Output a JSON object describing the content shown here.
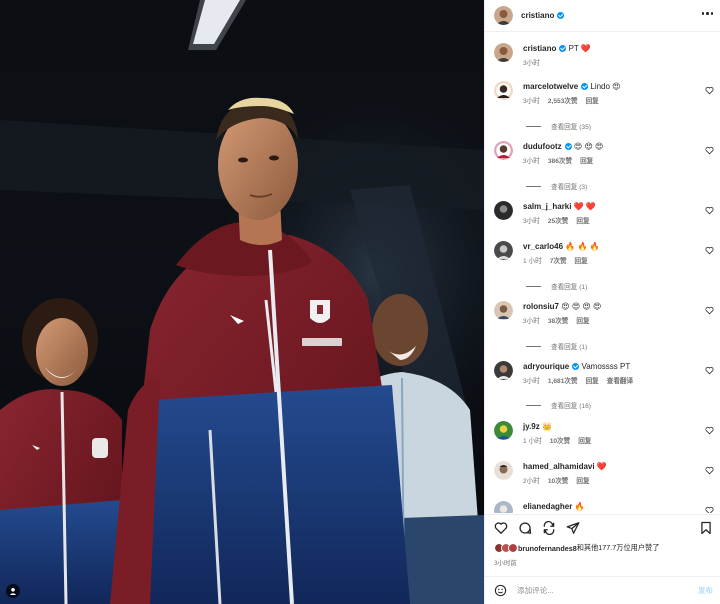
{
  "header": {
    "username": "cristiano",
    "verified": true
  },
  "caption": {
    "username": "cristiano",
    "text": "PT ❤️",
    "time": "3小时"
  },
  "comments": [
    {
      "username": "marcelotwelve",
      "verified": true,
      "text": "Lindo 😍",
      "time": "3小时",
      "likes": "2,553次赞",
      "reply": "回复",
      "translate": "",
      "view_replies": "查看回复 (35)"
    },
    {
      "username": "dudufootz",
      "verified": true,
      "text": "😍 😍 😍",
      "time": "3小时",
      "likes": "386次赞",
      "reply": "回复",
      "translate": "",
      "view_replies": "查看回复 (3)"
    },
    {
      "username": "salm_j_harki",
      "verified": false,
      "text": "❤️ ❤️",
      "time": "3小时",
      "likes": "25次赞",
      "reply": "回复",
      "translate": "",
      "view_replies": ""
    },
    {
      "username": "vr_carlo46",
      "verified": false,
      "text": "🔥 🔥 🔥",
      "time": "1 小时",
      "likes": "7次赞",
      "reply": "回复",
      "translate": "",
      "view_replies": "查看回复 (1)"
    },
    {
      "username": "rolonsiu7",
      "verified": false,
      "text": "😍 😍 😍 😍",
      "time": "3小时",
      "likes": "38次赞",
      "reply": "回复",
      "translate": "",
      "view_replies": "查看回复 (1)"
    },
    {
      "username": "adryourique",
      "verified": true,
      "text": "Vamossss PT",
      "time": "3小时",
      "likes": "1,681次赞",
      "reply": "回复",
      "translate": "查看翻译",
      "view_replies": "查看回复 (16)"
    },
    {
      "username": "jy.9z",
      "verified": false,
      "text": "👑",
      "time": "1 小时",
      "likes": "10次赞",
      "reply": "回复",
      "translate": "",
      "view_replies": ""
    },
    {
      "username": "hamed_alhamidavi",
      "verified": false,
      "text": "❤️",
      "time": "2小时",
      "likes": "10次赞",
      "reply": "回复",
      "translate": "",
      "view_replies": ""
    },
    {
      "username": "elianedagher",
      "verified": false,
      "text": "🔥",
      "time": "",
      "likes": "",
      "reply": "",
      "translate": "",
      "view_replies": ""
    }
  ],
  "likes": {
    "user": "brunofernandes8",
    "rest": "和其他177.7万位用户赞了"
  },
  "post_time": "3小时前",
  "add_comment": {
    "placeholder": "添加评论...",
    "publish": "发布"
  },
  "icons": [
    "more-icon",
    "heart-icon",
    "comment-icon",
    "share-icon",
    "send-icon",
    "bookmark-icon",
    "emoji-icon",
    "user-tag-icon",
    "verified-icon"
  ],
  "colors": {
    "verified": "#0095f6",
    "publish": "#b2dffc",
    "jersey_red": "#7a1a22",
    "jersey_blue": "#1a3b7a"
  }
}
